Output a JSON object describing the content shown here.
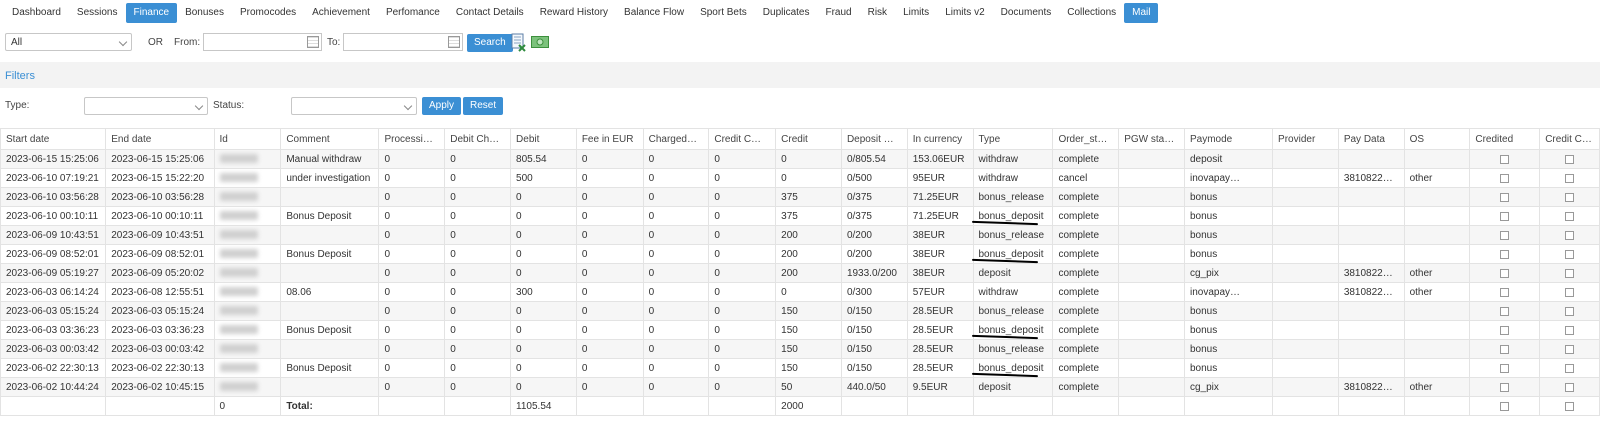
{
  "tabs": [
    {
      "label": "Dashboard",
      "active": false
    },
    {
      "label": "Sessions",
      "active": false
    },
    {
      "label": "Finance",
      "active": true
    },
    {
      "label": "Bonuses",
      "active": false
    },
    {
      "label": "Promocodes",
      "active": false
    },
    {
      "label": "Achievement",
      "active": false
    },
    {
      "label": "Perfomance",
      "active": false
    },
    {
      "label": "Contact Details",
      "active": false
    },
    {
      "label": "Reward History",
      "active": false
    },
    {
      "label": "Balance Flow",
      "active": false
    },
    {
      "label": "Sport Bets",
      "active": false
    },
    {
      "label": "Duplicates",
      "active": false
    },
    {
      "label": "Fraud",
      "active": false
    },
    {
      "label": "Risk",
      "active": false
    },
    {
      "label": "Limits",
      "active": false
    },
    {
      "label": "Limits v2",
      "active": false
    },
    {
      "label": "Documents",
      "active": false
    },
    {
      "label": "Collections",
      "active": false
    },
    {
      "label": "Mail",
      "active": true
    }
  ],
  "toolbar": {
    "scope_value": "All",
    "or_label": "OR",
    "from_label": "From:",
    "to_label": "To:",
    "search_label": "Search",
    "from_value": "",
    "to_value": ""
  },
  "filters": {
    "title": "Filters",
    "type_label": "Type:",
    "status_label": "Status:",
    "type_value": "",
    "status_value": "",
    "apply_label": "Apply",
    "reset_label": "Reset"
  },
  "table": {
    "columns": [
      "Start date",
      "End date",
      "Id",
      "Comment",
      "Processi…",
      "Debit Ch…",
      "Debit",
      "Fee in EUR",
      "Charged…",
      "Credit C…",
      "Credit",
      "Deposit …",
      "In currency",
      "Type",
      "Order_st…",
      "PGW sta…",
      "Paymode",
      "Provider",
      "Pay Data",
      "OS",
      "Credited",
      "Credit Cl…"
    ],
    "rows": [
      [
        "2023-06-15 15:25:06",
        "2023-06-15 15:25:06",
        "",
        "Manual withdraw",
        "0",
        "0",
        "805.54",
        "0",
        "0",
        "0",
        "0",
        "0/805.54",
        "153.06EUR",
        "withdraw",
        "complete",
        "",
        "deposit",
        "",
        "",
        ""
      ],
      [
        "2023-06-10 07:19:21",
        "2023-06-15 15:22:20",
        "",
        "under investigation",
        "0",
        "0",
        "500",
        "0",
        "0",
        "0",
        "0",
        "0/500",
        "95EUR",
        "withdraw",
        "cancel",
        "",
        "inovapay…",
        "",
        "3810822…",
        "other"
      ],
      [
        "2023-06-10 03:56:28",
        "2023-06-10 03:56:28",
        "",
        "",
        "0",
        "0",
        "0",
        "0",
        "0",
        "0",
        "375",
        "0/375",
        "71.25EUR",
        "bonus_release",
        "complete",
        "",
        "bonus",
        "",
        "",
        ""
      ],
      [
        "2023-06-10 00:10:11",
        "2023-06-10 00:10:11",
        "",
        "Bonus Deposit",
        "0",
        "0",
        "0",
        "0",
        "0",
        "0",
        "375",
        "0/375",
        "71.25EUR",
        "bonus_deposit",
        "complete",
        "",
        "bonus",
        "",
        "",
        ""
      ],
      [
        "2023-06-09 10:43:51",
        "2023-06-09 10:43:51",
        "",
        "",
        "0",
        "0",
        "0",
        "0",
        "0",
        "0",
        "200",
        "0/200",
        "38EUR",
        "bonus_release",
        "complete",
        "",
        "bonus",
        "",
        "",
        ""
      ],
      [
        "2023-06-09 08:52:01",
        "2023-06-09 08:52:01",
        "",
        "Bonus Deposit",
        "0",
        "0",
        "0",
        "0",
        "0",
        "0",
        "200",
        "0/200",
        "38EUR",
        "bonus_deposit",
        "complete",
        "",
        "bonus",
        "",
        "",
        ""
      ],
      [
        "2023-06-09 05:19:27",
        "2023-06-09 05:20:02",
        "",
        "",
        "0",
        "0",
        "0",
        "0",
        "0",
        "0",
        "200",
        "1933.0/200",
        "38EUR",
        "deposit",
        "complete",
        "",
        "cg_pix",
        "",
        "3810822…",
        "other"
      ],
      [
        "2023-06-03 06:14:24",
        "2023-06-08 12:55:51",
        "",
        "08.06",
        "0",
        "0",
        "300",
        "0",
        "0",
        "0",
        "0",
        "0/300",
        "57EUR",
        "withdraw",
        "complete",
        "",
        "inovapay…",
        "",
        "3810822…",
        "other"
      ],
      [
        "2023-06-03 05:15:24",
        "2023-06-03 05:15:24",
        "",
        "",
        "0",
        "0",
        "0",
        "0",
        "0",
        "0",
        "150",
        "0/150",
        "28.5EUR",
        "bonus_release",
        "complete",
        "",
        "bonus",
        "",
        "",
        ""
      ],
      [
        "2023-06-03 03:36:23",
        "2023-06-03 03:36:23",
        "",
        "Bonus Deposit",
        "0",
        "0",
        "0",
        "0",
        "0",
        "0",
        "150",
        "0/150",
        "28.5EUR",
        "bonus_deposit",
        "complete",
        "",
        "bonus",
        "",
        "",
        ""
      ],
      [
        "2023-06-03 00:03:42",
        "2023-06-03 00:03:42",
        "",
        "",
        "0",
        "0",
        "0",
        "0",
        "0",
        "0",
        "150",
        "0/150",
        "28.5EUR",
        "bonus_release",
        "complete",
        "",
        "bonus",
        "",
        "",
        ""
      ],
      [
        "2023-06-02 22:30:13",
        "2023-06-02 22:30:13",
        "",
        "Bonus Deposit",
        "0",
        "0",
        "0",
        "0",
        "0",
        "0",
        "150",
        "0/150",
        "28.5EUR",
        "bonus_deposit",
        "complete",
        "",
        "bonus",
        "",
        "",
        ""
      ],
      [
        "2023-06-02 10:44:24",
        "2023-06-02 10:45:15",
        "",
        "",
        "0",
        "0",
        "0",
        "0",
        "0",
        "0",
        "50",
        "440.0/50",
        "9.5EUR",
        "deposit",
        "complete",
        "",
        "cg_pix",
        "",
        "3810822…",
        "other"
      ]
    ],
    "total": {
      "id": "0",
      "label": "Total:",
      "debit": "1105.54",
      "credit": "2000"
    }
  },
  "colors": {
    "accent": "#3b8fd4",
    "underline": "#000000"
  }
}
